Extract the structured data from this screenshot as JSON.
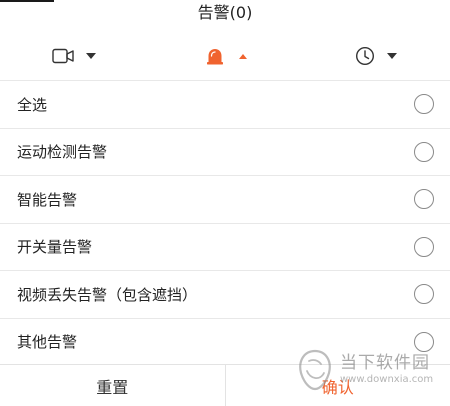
{
  "header": {
    "title": "告警(0)"
  },
  "filters": {
    "camera_icon": "video-camera-icon",
    "alarm_icon": "alarm-bell-icon",
    "clock_icon": "clock-icon"
  },
  "options": [
    {
      "label": "全选"
    },
    {
      "label": "运动检测告警"
    },
    {
      "label": "智能告警"
    },
    {
      "label": "开关量告警"
    },
    {
      "label": "视频丢失告警（包含遮挡）"
    },
    {
      "label": "其他告警"
    }
  ],
  "footer": {
    "reset_label": "重置",
    "confirm_label": "确认"
  },
  "watermark": {
    "name": "当下软件园",
    "url": "www.downxia.com"
  },
  "colors": {
    "accent": "#f0632f",
    "divider": "#e8e8e8",
    "text": "#222222"
  }
}
